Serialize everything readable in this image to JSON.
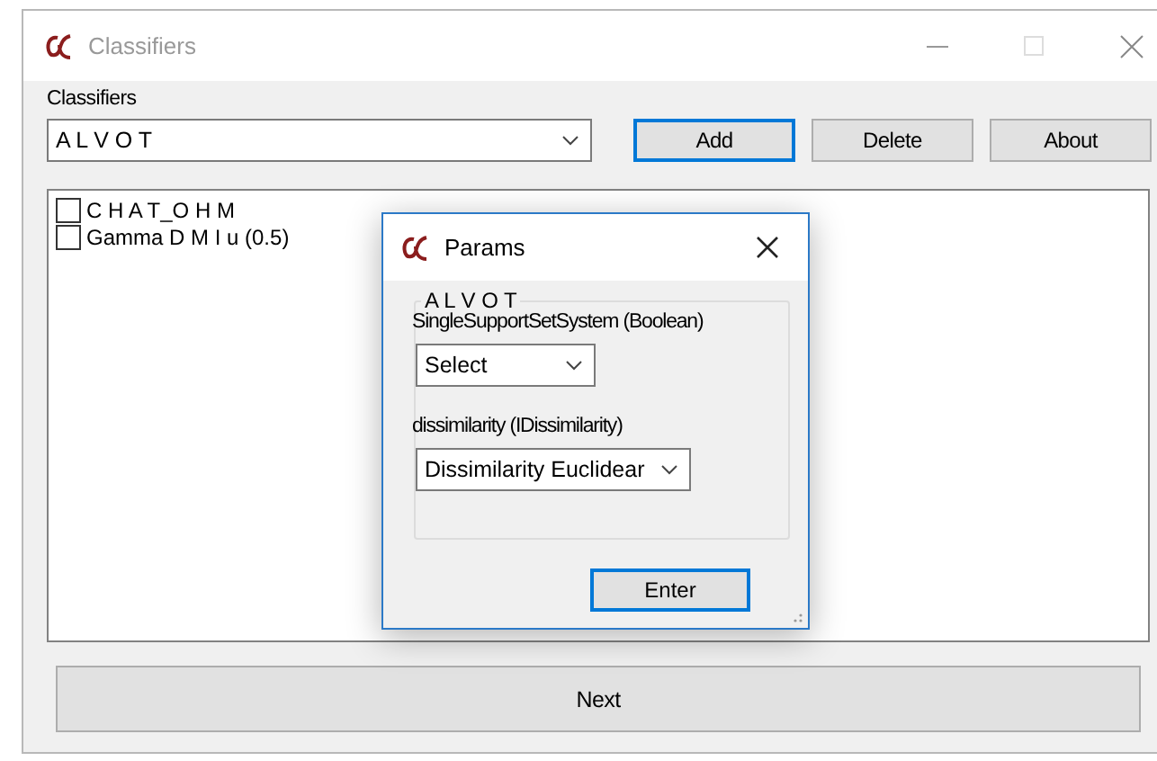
{
  "window": {
    "title": "Classifiers"
  },
  "classifier_label": "Classifiers",
  "classifier_select": {
    "value": "A L V O T"
  },
  "buttons": [
    {
      "label": "Add",
      "focused": true
    },
    {
      "label": "Delete",
      "focused": false
    },
    {
      "label": "About",
      "focused": false
    }
  ],
  "classifiers": [
    {
      "label": "C H A T_O H M",
      "checked": false
    },
    {
      "label": "Gamma D M I u (0.5)",
      "checked": false
    }
  ],
  "params_dialog": {
    "title": "Params",
    "group_title": "A L V O T",
    "fields": [
      {
        "label": "SingleSupportSetSystem (Boolean)",
        "value": "Select"
      },
      {
        "label": "dissimilarity (IDissimilarity)",
        "value": "Dissimilarity Euclidear"
      }
    ],
    "enter_button": "Enter"
  },
  "next_button": "Next"
}
